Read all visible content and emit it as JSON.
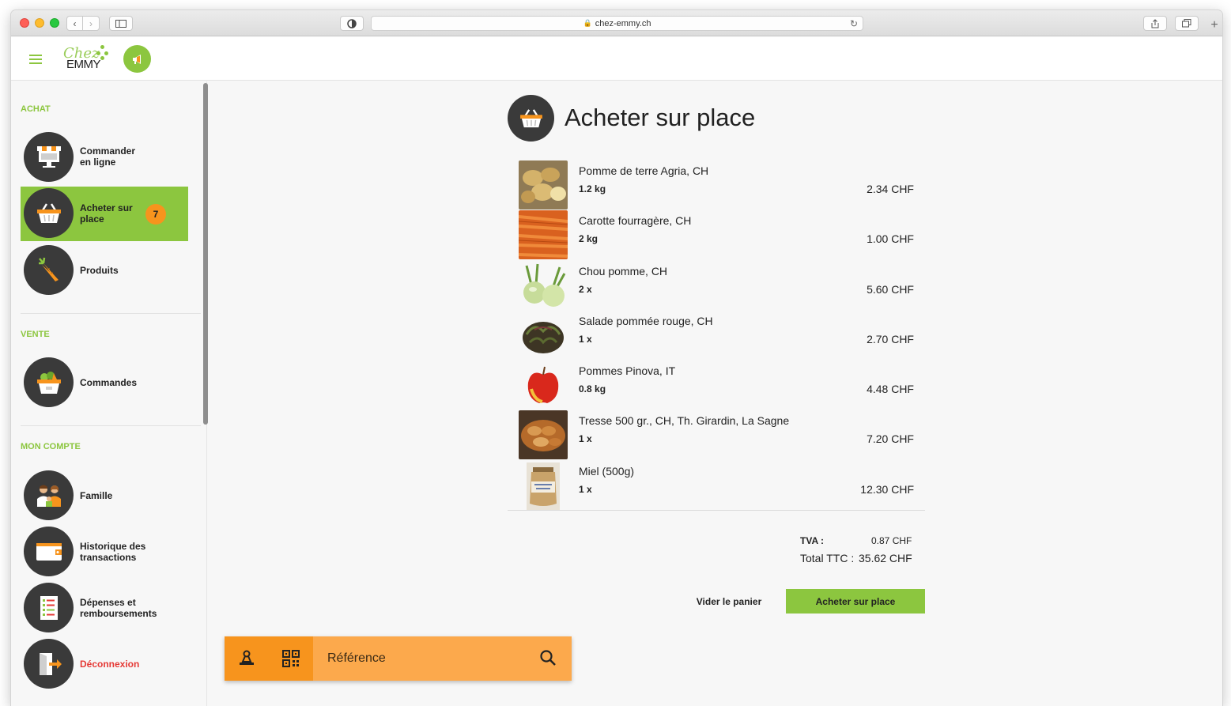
{
  "browser": {
    "url": "chez-emmy.ch"
  },
  "logo": {
    "chez": "Chez",
    "emmy": "EMMY"
  },
  "sidebar": {
    "sections": {
      "achat": "ACHAT",
      "vente": "VENTE",
      "compte": "MON COMPTE"
    },
    "items": [
      {
        "label_line1": "Commander",
        "label_line2": "en ligne",
        "icon": "storefront-icon"
      },
      {
        "label_line1": "Acheter sur",
        "label_line2": "place",
        "icon": "basket-icon",
        "badge": "7"
      },
      {
        "label_line1": "Produits",
        "label_line2": "",
        "icon": "carrot-icon"
      },
      {
        "label_line1": "Commandes",
        "label_line2": "",
        "icon": "vegetable-basket-icon"
      },
      {
        "label_line1": "Famille",
        "label_line2": "",
        "icon": "family-icon"
      },
      {
        "label_line1": "Historique des",
        "label_line2": "transactions",
        "icon": "wallet-icon"
      },
      {
        "label_line1": "Dépenses et",
        "label_line2": "remboursements",
        "icon": "receipt-icon"
      },
      {
        "label_line1": "Déconnexion",
        "label_line2": "",
        "icon": "logout-door-icon"
      }
    ]
  },
  "main": {
    "title": "Acheter sur place",
    "products": [
      {
        "name": "Pomme de terre Agria, CH",
        "qty": "1.2 kg",
        "price": "2.34 CHF",
        "thumb": "potato"
      },
      {
        "name": "Carotte fourragère, CH",
        "qty": "2 kg",
        "price": "1.00 CHF",
        "thumb": "carrot"
      },
      {
        "name": "Chou pomme, CH",
        "qty": "2 x",
        "price": "5.60 CHF",
        "thumb": "kohlrabi"
      },
      {
        "name": "Salade pommée rouge, CH",
        "qty": "1 x",
        "price": "2.70 CHF",
        "thumb": "lettuce"
      },
      {
        "name": "Pommes Pinova, IT",
        "qty": "0.8 kg",
        "price": "4.48 CHF",
        "thumb": "apple"
      },
      {
        "name": "Tresse 500 gr., CH, Th. Girardin, La Sagne",
        "qty": "1 x",
        "price": "7.20 CHF",
        "thumb": "bread"
      },
      {
        "name": "Miel (500g)",
        "qty": "1 x",
        "price": "12.30 CHF",
        "thumb": "honey"
      }
    ],
    "tva_label": "TVA :",
    "tva_value": "0.87 CHF",
    "total_label": "Total TTC :",
    "total_value": "35.62 CHF",
    "clear_label": "Vider le panier",
    "buy_label": "Acheter sur place"
  },
  "search": {
    "placeholder": "Référence"
  },
  "colors": {
    "brand_green": "#8cc63f",
    "accent_orange": "#f7941d",
    "logout_red": "#e53935"
  }
}
